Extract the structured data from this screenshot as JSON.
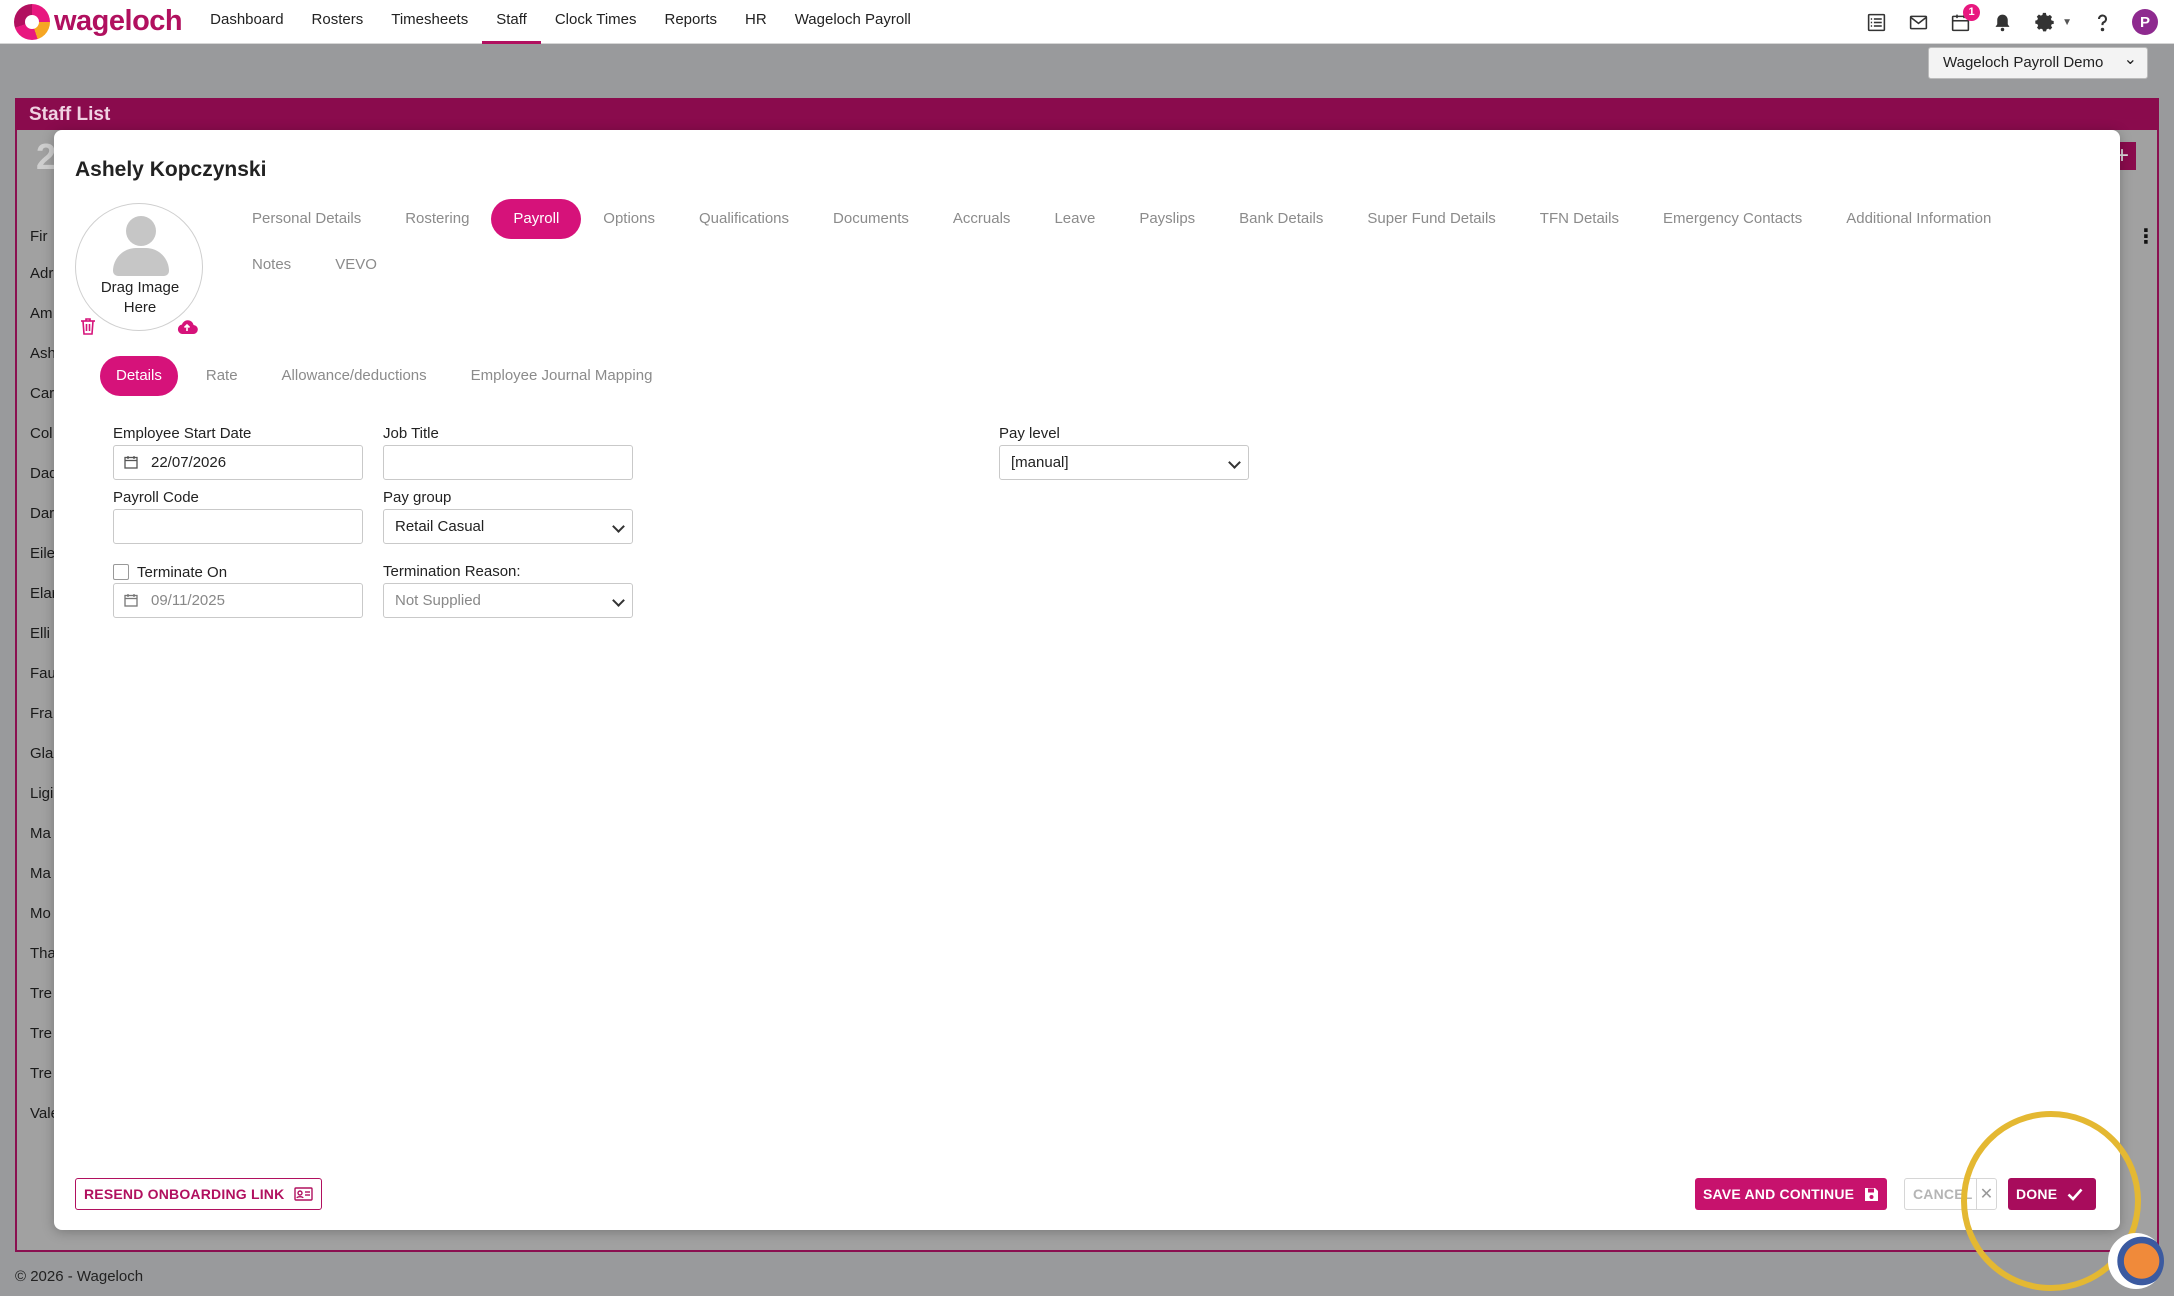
{
  "brand": {
    "logo_text": "wageloch",
    "accent": "#d6127a",
    "dark_accent": "#8a0b4d",
    "highlight": "#e4b832"
  },
  "nav": {
    "links": [
      "Dashboard",
      "Rosters",
      "Timesheets",
      "Staff",
      "Clock Times",
      "Reports",
      "HR",
      "Wageloch Payroll"
    ],
    "active": "Staff",
    "icons": [
      "checklist-icon",
      "mail-icon",
      "calendar-icon",
      "bell-icon",
      "gear-icon",
      "help-icon"
    ],
    "calendar_badge": "1",
    "avatar_initial": "P"
  },
  "company_select": {
    "value": "Wageloch Payroll Demo"
  },
  "staff_list": {
    "title": "Staff List",
    "count": "2",
    "rows": [
      "Fir",
      "Adr",
      "Am",
      "Ash",
      "Car",
      "Col",
      "Dad",
      "Dar",
      "Eile",
      "Elar",
      "Elli",
      "Fau",
      "Fra",
      "Gla",
      "Ligi",
      "Ma",
      "Ma",
      "Mo",
      "Tha",
      "Tre",
      "Tre",
      "Tre",
      "Vale"
    ]
  },
  "modal": {
    "employee_name": "Ashely Kopczynski",
    "photo": {
      "drop_text_line1": "Drag Image",
      "drop_text_line2": "Here"
    },
    "tabs": [
      "Personal Details",
      "Rostering",
      "Payroll",
      "Options",
      "Qualifications",
      "Documents",
      "Accruals",
      "Leave",
      "Payslips",
      "Bank Details",
      "Super Fund Details",
      "TFN Details",
      "Emergency Contacts",
      "Additional Information",
      "Notes",
      "VEVO"
    ],
    "active_tab": "Payroll",
    "subtabs": [
      "Details",
      "Rate",
      "Allowance/deductions",
      "Employee Journal Mapping"
    ],
    "active_subtab": "Details",
    "form": {
      "start_date_label": "Employee Start Date",
      "start_date_value": "22/07/2026",
      "job_title_label": "Job Title",
      "job_title_value": "",
      "pay_level_label": "Pay level",
      "pay_level_value": "[manual]",
      "payroll_code_label": "Payroll Code",
      "payroll_code_value": "",
      "pay_group_label": "Pay group",
      "pay_group_value": "Retail Casual",
      "terminate_label": "Terminate On",
      "terminate_checked": false,
      "terminate_date_value": "09/11/2025",
      "termination_reason_label": "Termination Reason:",
      "termination_reason_value": "Not Supplied"
    },
    "buttons": {
      "resend": "RESEND ONBOARDING LINK",
      "save_continue": "SAVE AND CONTINUE",
      "cancel": "CANCEL",
      "done": "DONE"
    }
  },
  "footer": {
    "text": "© 2026 - Wageloch"
  }
}
